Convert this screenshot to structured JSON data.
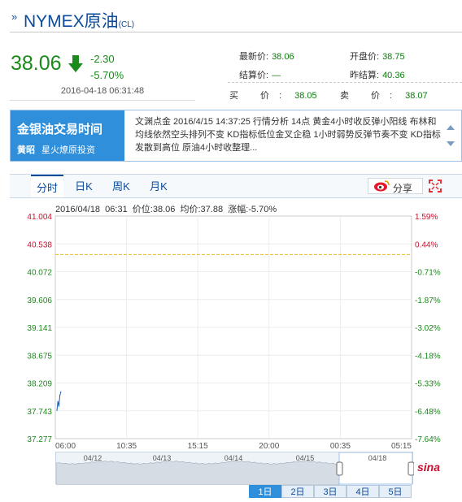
{
  "header": {
    "title_prefix": "»",
    "title": "NYMEX原油",
    "code": "(CL)"
  },
  "quote": {
    "price": "38.06",
    "change": "-2.30",
    "change_pct": "-5.70%",
    "timestamp": "2016-04-18 06:31:48",
    "color_down": "#1a8a1a"
  },
  "stats": {
    "latest_label": "最新价:",
    "latest_value": "38.06",
    "open_label": "开盘价:",
    "open_value": "38.75",
    "settle_label": "结算价:",
    "settle_value": "—",
    "prev_settle_label": "昨结算:",
    "prev_settle_value": "40.36",
    "buy_label": "买 价:",
    "buy_value": "38.05",
    "sell_label": "卖 价:",
    "sell_value": "38.07"
  },
  "news": {
    "badge_title": "金银油交易时间",
    "host": "黄昭",
    "host_tag": "星火燎原投资",
    "text": "文渊点金 2016/4/15 14:37:25 行情分析 14点 黄金4小时收反弹小阳线 布林和均线依然空头排列不变 KD指标低位金叉企稳 1小时弱势反弹节奏不变 KD指标发散到高位 原油4小时收整理..."
  },
  "tabs": [
    {
      "label": "分时",
      "active": true
    },
    {
      "label": "日K",
      "active": false
    },
    {
      "label": "周K",
      "active": false
    },
    {
      "label": "月K",
      "active": false
    }
  ],
  "share_label": "分享",
  "chart_info": "2016/04/18  06:31  价位:38.06  均价:37.88  涨幅:-5.70%",
  "chart_data": {
    "type": "line",
    "title": "",
    "y_ticks_left": [
      "41.004",
      "40.538",
      "40.072",
      "39.606",
      "39.141",
      "38.675",
      "38.209",
      "37.743",
      "37.277"
    ],
    "y_ticks_right": [
      "1.59%",
      "0.44%",
      "-0.71%",
      "-1.87%",
      "-3.02%",
      "-4.18%",
      "-5.33%",
      "-6.48%",
      "-7.64%"
    ],
    "x_ticks": [
      "06:00",
      "10:35",
      "15:15",
      "20:00",
      "00:35",
      "05:15"
    ],
    "ylim": [
      37.277,
      41.004
    ],
    "prev_settle": 40.36,
    "series": [
      {
        "values": [
          37.75,
          37.9,
          37.82,
          38.0,
          38.06
        ]
      }
    ]
  },
  "mini_nav": {
    "dates": [
      "04/12",
      "04/13",
      "04/14",
      "04/15",
      "04/18"
    ]
  },
  "ranges": [
    {
      "label": "1日",
      "active": true
    },
    {
      "label": "2日",
      "active": false
    },
    {
      "label": "3日",
      "active": false
    },
    {
      "label": "4日",
      "active": false
    },
    {
      "label": "5日",
      "active": false
    }
  ],
  "logo_text": "sina"
}
